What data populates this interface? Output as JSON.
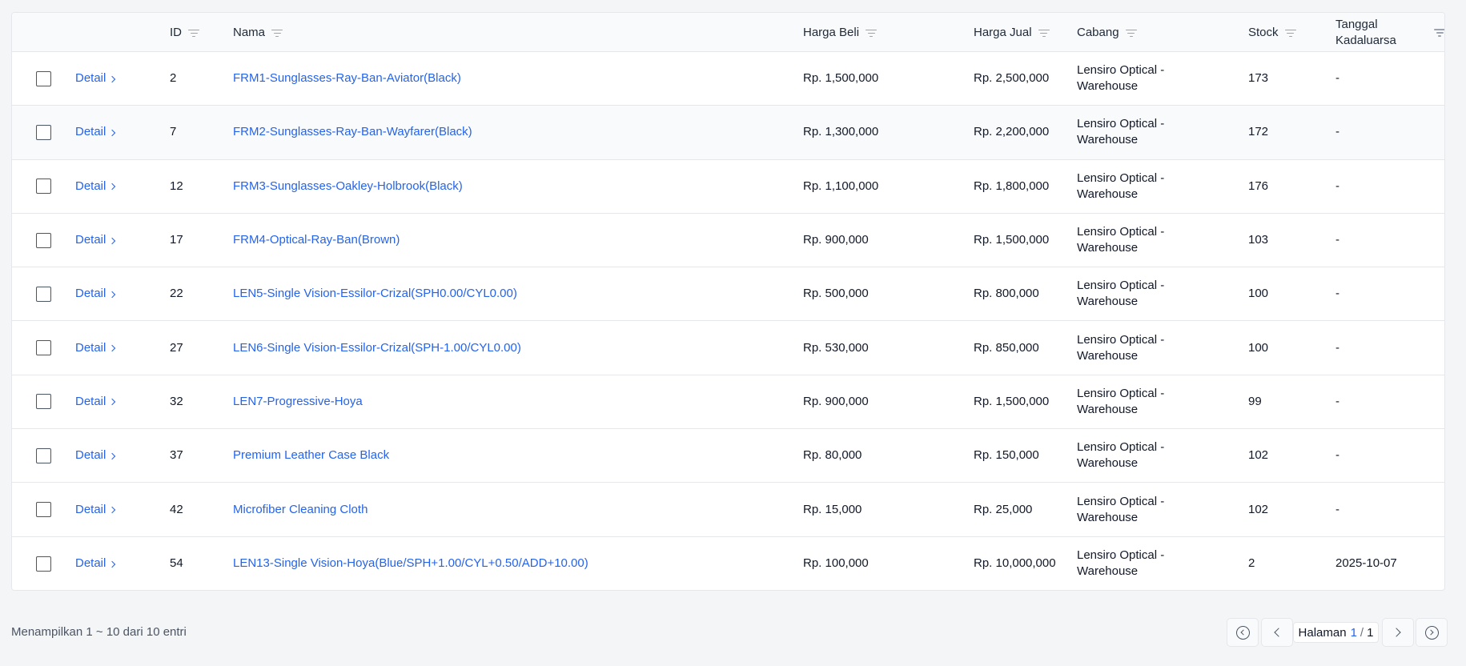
{
  "table": {
    "columns": {
      "id": "ID",
      "nama": "Nama",
      "harga_beli": "Harga Beli",
      "harga_jual": "Harga Jual",
      "cabang": "Cabang",
      "stock": "Stock",
      "tanggal": "Tanggal Kadaluarsa"
    },
    "detail_label": "Detail",
    "rows": [
      {
        "id": "2",
        "nama": "FRM1-Sunglasses-Ray-Ban-Aviator(Black)",
        "harga_beli": "Rp. 1,500,000",
        "harga_jual": "Rp. 2,500,000",
        "cabang": "Lensiro Optical - Warehouse",
        "stock": "173",
        "tanggal": "-"
      },
      {
        "id": "7",
        "nama": "FRM2-Sunglasses-Ray-Ban-Wayfarer(Black)",
        "harga_beli": "Rp. 1,300,000",
        "harga_jual": "Rp. 2,200,000",
        "cabang": "Lensiro Optical - Warehouse",
        "stock": "172",
        "tanggal": "-"
      },
      {
        "id": "12",
        "nama": "FRM3-Sunglasses-Oakley-Holbrook(Black)",
        "harga_beli": "Rp. 1,100,000",
        "harga_jual": "Rp. 1,800,000",
        "cabang": "Lensiro Optical - Warehouse",
        "stock": "176",
        "tanggal": "-"
      },
      {
        "id": "17",
        "nama": "FRM4-Optical-Ray-Ban(Brown)",
        "harga_beli": "Rp. 900,000",
        "harga_jual": "Rp. 1,500,000",
        "cabang": "Lensiro Optical - Warehouse",
        "stock": "103",
        "tanggal": "-"
      },
      {
        "id": "22",
        "nama": "LEN5-Single Vision-Essilor-Crizal(SPH0.00/CYL0.00)",
        "harga_beli": "Rp. 500,000",
        "harga_jual": "Rp. 800,000",
        "cabang": "Lensiro Optical - Warehouse",
        "stock": "100",
        "tanggal": "-"
      },
      {
        "id": "27",
        "nama": "LEN6-Single Vision-Essilor-Crizal(SPH-1.00/CYL0.00)",
        "harga_beli": "Rp. 530,000",
        "harga_jual": "Rp. 850,000",
        "cabang": "Lensiro Optical - Warehouse",
        "stock": "100",
        "tanggal": "-"
      },
      {
        "id": "32",
        "nama": "LEN7-Progressive-Hoya",
        "harga_beli": "Rp. 900,000",
        "harga_jual": "Rp. 1,500,000",
        "cabang": "Lensiro Optical - Warehouse",
        "stock": "99",
        "tanggal": "-"
      },
      {
        "id": "37",
        "nama": "Premium Leather Case Black",
        "harga_beli": "Rp. 80,000",
        "harga_jual": "Rp. 150,000",
        "cabang": "Lensiro Optical - Warehouse",
        "stock": "102",
        "tanggal": "-"
      },
      {
        "id": "42",
        "nama": "Microfiber Cleaning Cloth",
        "harga_beli": "Rp. 15,000",
        "harga_jual": "Rp. 25,000",
        "cabang": "Lensiro Optical - Warehouse",
        "stock": "102",
        "tanggal": "-"
      },
      {
        "id": "54",
        "nama": "LEN13-Single Vision-Hoya(Blue/SPH+1.00/CYL+0.50/ADD+10.00)",
        "harga_beli": "Rp. 100,000",
        "harga_jual": "Rp. 10,000,000",
        "cabang": "Lensiro Optical - Warehouse",
        "stock": "2",
        "tanggal": "2025-10-07"
      }
    ]
  },
  "footer": {
    "summary": "Menampilkan 1 ~ 10 dari 10 entri",
    "page_label": "Halaman",
    "current_page": "1",
    "separator": "/",
    "total_pages": "1"
  },
  "colors": {
    "link": "#2563eb",
    "header_bg": "#f9fafb",
    "page_bg": "#f4f5f7"
  }
}
